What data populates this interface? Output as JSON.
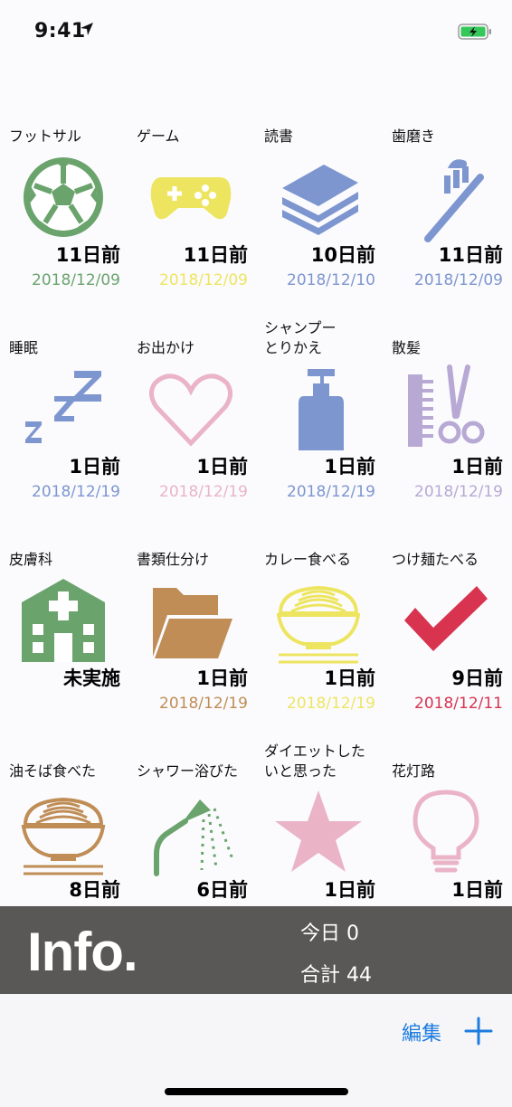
{
  "status": {
    "time": "9:41"
  },
  "colors": {
    "green": "#6aa36c",
    "yellow": "#ede560",
    "blue": "#7d96cf",
    "lavender": "#b7a9d4",
    "pink": "#eab4c6",
    "brown": "#bf8d55",
    "red": "#d8344f",
    "accent": "#1d7ce0"
  },
  "items": [
    {
      "title": "フットサル",
      "days": "11日前",
      "date": "2018/12/09",
      "icon": "soccer-ball-icon",
      "color": "#6aa36c"
    },
    {
      "title": "ゲーム",
      "days": "11日前",
      "date": "2018/12/09",
      "icon": "gamepad-icon",
      "color": "#ede560"
    },
    {
      "title": "読書",
      "days": "10日前",
      "date": "2018/12/10",
      "icon": "books-icon",
      "color": "#7d96cf"
    },
    {
      "title": "歯磨き",
      "days": "11日前",
      "date": "2018/12/09",
      "icon": "toothbrush-icon",
      "color": "#7d96cf"
    },
    {
      "title": "睡眠",
      "days": "1日前",
      "date": "2018/12/19",
      "icon": "zzz-icon",
      "color": "#7d96cf"
    },
    {
      "title": "お出かけ",
      "days": "1日前",
      "date": "2018/12/19",
      "icon": "heart-icon",
      "color": "#eab4c6"
    },
    {
      "title": "シャンプー\nとりかえ",
      "days": "1日前",
      "date": "2018/12/19",
      "icon": "pump-bottle-icon",
      "color": "#7d96cf"
    },
    {
      "title": "散髪",
      "days": "1日前",
      "date": "2018/12/19",
      "icon": "comb-scissors-icon",
      "color": "#b7a9d4"
    },
    {
      "title": "皮膚科",
      "days": "未実施",
      "date": "",
      "icon": "hospital-icon",
      "color": "#6aa36c"
    },
    {
      "title": "書類仕分け",
      "days": "1日前",
      "date": "2018/12/19",
      "icon": "folder-icon",
      "color": "#bf8d55"
    },
    {
      "title": "カレー食べる",
      "days": "1日前",
      "date": "2018/12/19",
      "icon": "noodle-bowl-icon",
      "color": "#ede560"
    },
    {
      "title": "つけ麺たべる",
      "days": "9日前",
      "date": "2018/12/11",
      "icon": "checkmark-icon",
      "color": "#d8344f"
    },
    {
      "title": "油そば食べた",
      "days": "8日前",
      "date": "",
      "icon": "noodle-bowl-icon",
      "color": "#bf8d55"
    },
    {
      "title": "シャワー浴びた",
      "days": "6日前",
      "date": "",
      "icon": "shower-icon",
      "color": "#6aa36c"
    },
    {
      "title": "ダイエットした\nいと思った",
      "days": "1日前",
      "date": "",
      "icon": "star-icon",
      "color": "#eab4c6"
    },
    {
      "title": "花灯路",
      "days": "1日前",
      "date": "",
      "icon": "lightbulb-icon",
      "color": "#eab4c6"
    }
  ],
  "info": {
    "title": "Info.",
    "today": "今日 0",
    "total": "合計 44"
  },
  "toolbar": {
    "edit_label": "編集"
  }
}
